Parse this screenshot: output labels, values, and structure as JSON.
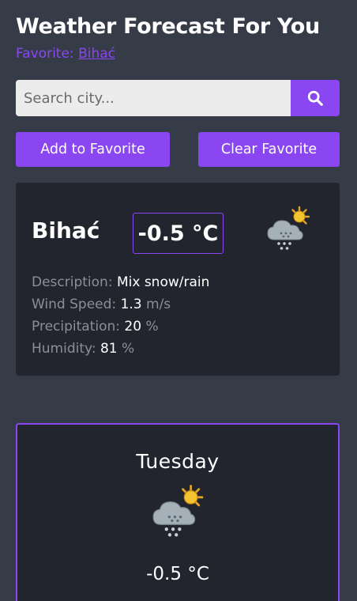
{
  "header": {
    "title": "Weather Forecast For You",
    "favorite_label": "Favorite:",
    "favorite_city": "Bihać"
  },
  "search": {
    "placeholder": "Search city...",
    "value": "",
    "button_icon": "search-icon"
  },
  "actions": {
    "add_favorite": "Add to Favorite",
    "clear_favorite": "Clear Favorite"
  },
  "current": {
    "city": "Bihać",
    "temperature": "-0.5 °C",
    "icon": "snow-rain-sun-icon",
    "description_label": "Description:",
    "description": "Mix snow/rain",
    "wind_label": "Wind Speed:",
    "wind_value": "1.3",
    "wind_unit": "m/s",
    "precip_label": "Precipitation:",
    "precip_value": "20",
    "precip_unit": "%",
    "humidity_label": "Humidity:",
    "humidity_value": "81",
    "humidity_unit": "%"
  },
  "forecast": [
    {
      "day": "Tuesday",
      "icon": "snow-rain-sun-icon",
      "temperature": "-0.5 °C"
    }
  ],
  "colors": {
    "accent": "#8a46f0",
    "background": "#363c47",
    "card": "#22252e"
  }
}
